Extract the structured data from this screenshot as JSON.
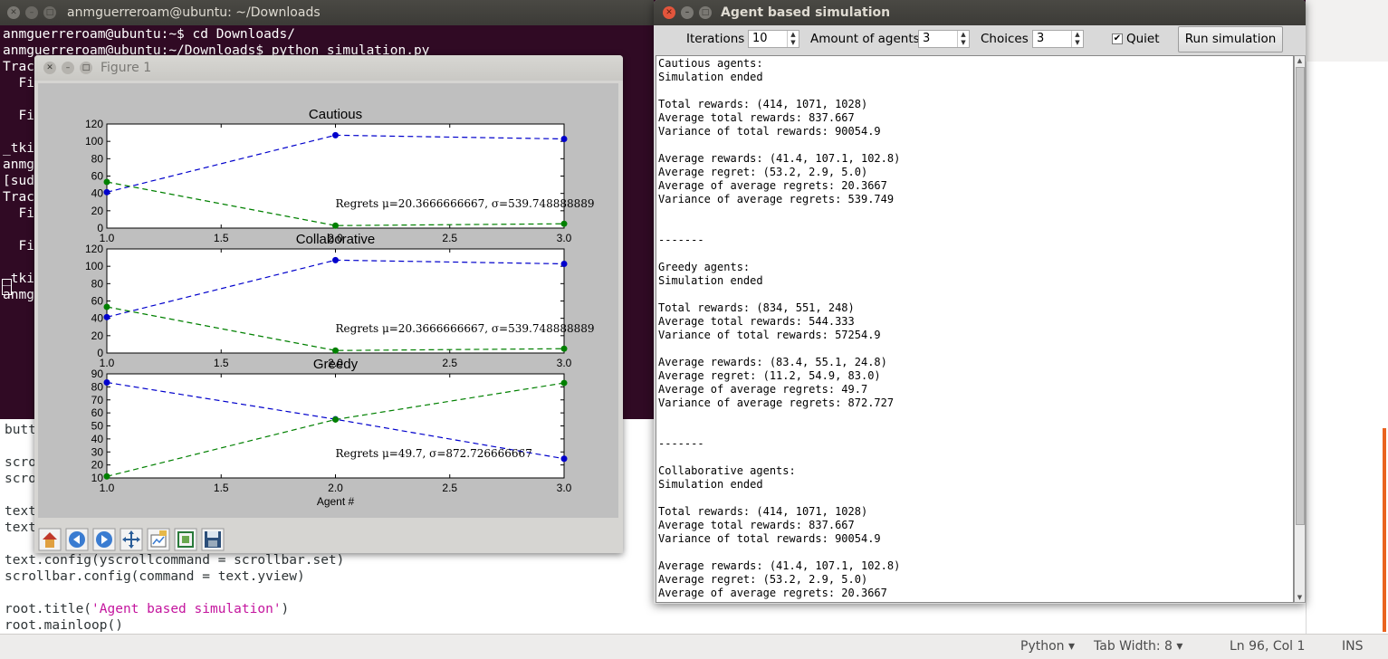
{
  "terminal": {
    "title": "anmguerreroam@ubuntu: ~/Downloads",
    "lines": [
      "anmguerreroam@ubuntu:~$ cd Downloads/",
      "anmguerreroam@ubuntu:~/Downloads$ python simulation.py",
      "Trac",
      "  Fi",
      "",
      "  Fi",
      "",
      "_tki",
      "anmg",
      "[sud",
      "Trac",
      "  Fi",
      "",
      "  Fi",
      "",
      "_tki",
      "anmg"
    ]
  },
  "editor": {
    "lines": [
      {
        "pre": "butt",
        "str": "",
        "post": ""
      },
      {
        "pre": "",
        "str": "",
        "post": ""
      },
      {
        "pre": "scro",
        "str": "",
        "post": ""
      },
      {
        "pre": "scro",
        "str": "",
        "post": ""
      },
      {
        "pre": "",
        "str": "",
        "post": ""
      },
      {
        "pre": "text",
        "str": "",
        "post": ""
      },
      {
        "pre": "text",
        "str": "",
        "post": ""
      },
      {
        "pre": "",
        "str": "",
        "post": ""
      },
      {
        "pre": "text.config(yscrollcommand = scrollbar.set)",
        "str": "",
        "post": ""
      },
      {
        "pre": "scrollbar.config(command = text.yview)",
        "str": "",
        "post": ""
      },
      {
        "pre": "",
        "str": "",
        "post": ""
      },
      {
        "pre": "root.title(",
        "str": "'Agent based simulation'",
        "post": ")"
      },
      {
        "pre": "root.mainloop()",
        "str": "",
        "post": ""
      }
    ],
    "status": {
      "language": "Python",
      "tab_width": "Tab Width: 8",
      "position": "Ln 96, Col 1",
      "mode": "INS"
    }
  },
  "figure": {
    "title": "Figure 1",
    "toolbar": [
      "home-icon",
      "back-icon",
      "forward-icon",
      "pan-icon",
      "configure-subplots-icon",
      "zoom-rect-icon",
      "save-icon"
    ]
  },
  "chart_data": [
    {
      "type": "line",
      "title": "Cautious",
      "xlabel": "",
      "xlim": [
        1.0,
        3.0
      ],
      "ylim": [
        0,
        120
      ],
      "xticks": [
        "1.0",
        "1.5",
        "2.0",
        "2.5",
        "3.0"
      ],
      "yticks": [
        "0",
        "20",
        "40",
        "60",
        "80",
        "100",
        "120"
      ],
      "x": [
        1.0,
        2.0,
        3.0
      ],
      "series": [
        {
          "color": "#0000cc",
          "values": [
            41.4,
            107.1,
            102.8
          ]
        },
        {
          "color": "#008000",
          "values": [
            53.2,
            2.9,
            5.0
          ]
        }
      ],
      "annotation": "Regrets μ=20.3666666667, σ=539.748888889"
    },
    {
      "type": "line",
      "title": "Collaborative",
      "xlabel": "",
      "xlim": [
        1.0,
        3.0
      ],
      "ylim": [
        0,
        120
      ],
      "xticks": [
        "1.0",
        "1.5",
        "2.0",
        "2.5",
        "3.0"
      ],
      "yticks": [
        "0",
        "20",
        "40",
        "60",
        "80",
        "100",
        "120"
      ],
      "x": [
        1.0,
        2.0,
        3.0
      ],
      "series": [
        {
          "color": "#0000cc",
          "values": [
            41.4,
            107.1,
            102.8
          ]
        },
        {
          "color": "#008000",
          "values": [
            53.2,
            2.9,
            5.0
          ]
        }
      ],
      "annotation": "Regrets μ=20.3666666667, σ=539.748888889"
    },
    {
      "type": "line",
      "title": "Greedy",
      "xlabel": "Agent #",
      "xlim": [
        1.0,
        3.0
      ],
      "ylim": [
        10,
        90
      ],
      "xticks": [
        "1.0",
        "1.5",
        "2.0",
        "2.5",
        "3.0"
      ],
      "yticks": [
        "10",
        "20",
        "30",
        "40",
        "50",
        "60",
        "70",
        "80",
        "90"
      ],
      "x": [
        1.0,
        2.0,
        3.0
      ],
      "series": [
        {
          "color": "#0000cc",
          "values": [
            83.4,
            55.1,
            24.8
          ]
        },
        {
          "color": "#008000",
          "values": [
            11.2,
            54.9,
            83.0
          ]
        }
      ],
      "annotation": "Regrets μ=49.7, σ=872.726666667"
    }
  ],
  "sim": {
    "title": "Agent based simulation",
    "controls": {
      "iterations_label": "Iterations",
      "iterations_value": "10",
      "agents_label": "Amount of agents",
      "agents_value": "3",
      "choices_label": "Choices",
      "choices_value": "3",
      "quiet_label": "Quiet",
      "quiet_checked": "✔",
      "run_label": "Run simulation"
    },
    "output_lines": [
      "Cautious agents:",
      "Simulation ended",
      "",
      "Total rewards: (414, 1071, 1028)",
      "Average total rewards: 837.667",
      "Variance of total rewards: 90054.9",
      "",
      "Average rewards: (41.4, 107.1, 102.8)",
      "Average regret: (53.2, 2.9, 5.0)",
      "Average of average regrets: 20.3667",
      "Variance of average regrets: 539.749",
      "",
      "",
      "-------",
      "",
      "Greedy agents:",
      "Simulation ended",
      "",
      "Total rewards: (834, 551, 248)",
      "Average total rewards: 544.333",
      "Variance of total rewards: 57254.9",
      "",
      "Average rewards: (83.4, 55.1, 24.8)",
      "Average regret: (11.2, 54.9, 83.0)",
      "Average of average regrets: 49.7",
      "Variance of average regrets: 872.727",
      "",
      "",
      "-------",
      "",
      "Collaborative agents:",
      "Simulation ended",
      "",
      "Total rewards: (414, 1071, 1028)",
      "Average total rewards: 837.667",
      "Variance of total rewards: 90054.9",
      "",
      "Average rewards: (41.4, 107.1, 102.8)",
      "Average regret: (53.2, 2.9, 5.0)",
      "Average of average regrets: 20.3667"
    ]
  }
}
